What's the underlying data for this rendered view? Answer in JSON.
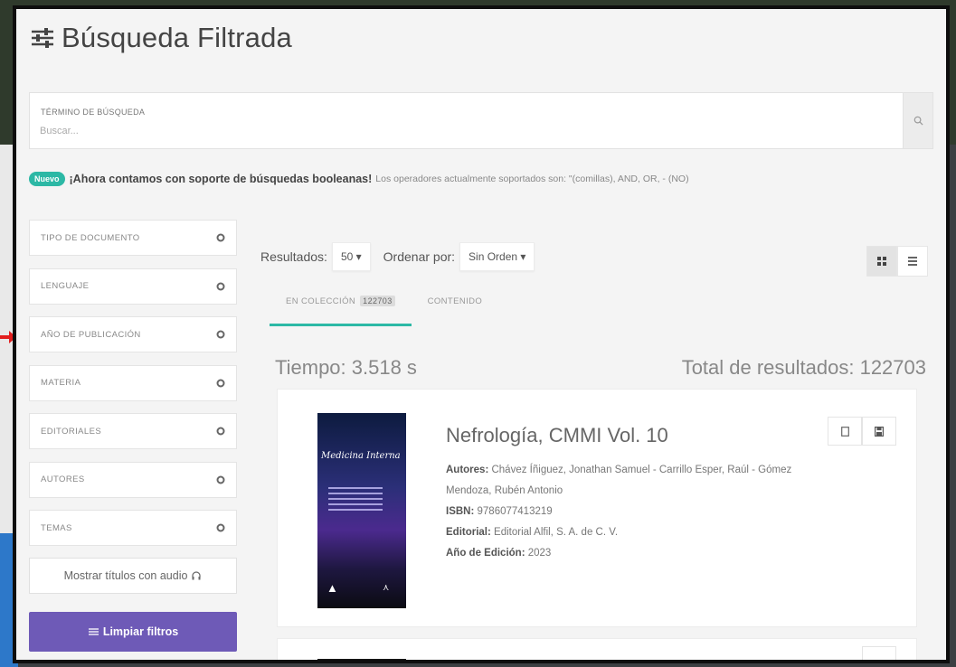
{
  "header": {
    "title": "Búsqueda Filtrada",
    "icon": "sliders-icon"
  },
  "search": {
    "label": "TÉRMINO DE BÚSQUEDA",
    "placeholder": "Buscar...",
    "value": "",
    "icon": "search-icon"
  },
  "notice": {
    "badge": "Nuevo",
    "headline": "¡Ahora contamos con soporte de búsquedas booleanas!",
    "detail": "Los operadores actualmente soportados son: \"(comillas), AND, OR, - (NO)"
  },
  "filters": {
    "items": [
      {
        "label": "TIPO DE DOCUMENTO"
      },
      {
        "label": "LENGUAJE"
      },
      {
        "label": "AÑO DE PUBLICACIÓN"
      },
      {
        "label": "MATERIA"
      },
      {
        "label": "EDITORIALES"
      },
      {
        "label": "AUTORES"
      },
      {
        "label": "TEMAS"
      }
    ],
    "audio_button": "Mostrar títulos con audio",
    "clear_button": "Limpiar filtros"
  },
  "results": {
    "results_label": "Resultados:",
    "per_page": "50",
    "order_label": "Ordenar por:",
    "order_value": "Sin Orden",
    "tabs": [
      {
        "label": "EN COLECCIÓN",
        "count": "122703",
        "active": true
      },
      {
        "label": "CONTENIDO",
        "active": false
      }
    ],
    "time_text": "Tiempo: 3.518 s",
    "total_text": "Total de resultados: 122703"
  },
  "items": [
    {
      "title": "Nefrología, CMMI Vol. 10",
      "authors_key": "Autores:",
      "authors_value": "Chávez Íñiguez, Jonathan Samuel - Carrillo Esper, Raúl - Gómez Mendoza, Rubén Antonio",
      "isbn_key": "ISBN:",
      "isbn_value": "9786077413219",
      "editorial_key": "Editorial:",
      "editorial_value": "Editorial Alfil, S. A. de C. V.",
      "year_key": "Año de Edición:",
      "year_value": "2023",
      "cover_title": "Medicina Interna"
    }
  ],
  "colors": {
    "accent_teal": "#2cb8a5",
    "clear_button": "#6e5ab7",
    "frame_border": "#0e0e0e",
    "arrow_red": "#e31e1e"
  }
}
